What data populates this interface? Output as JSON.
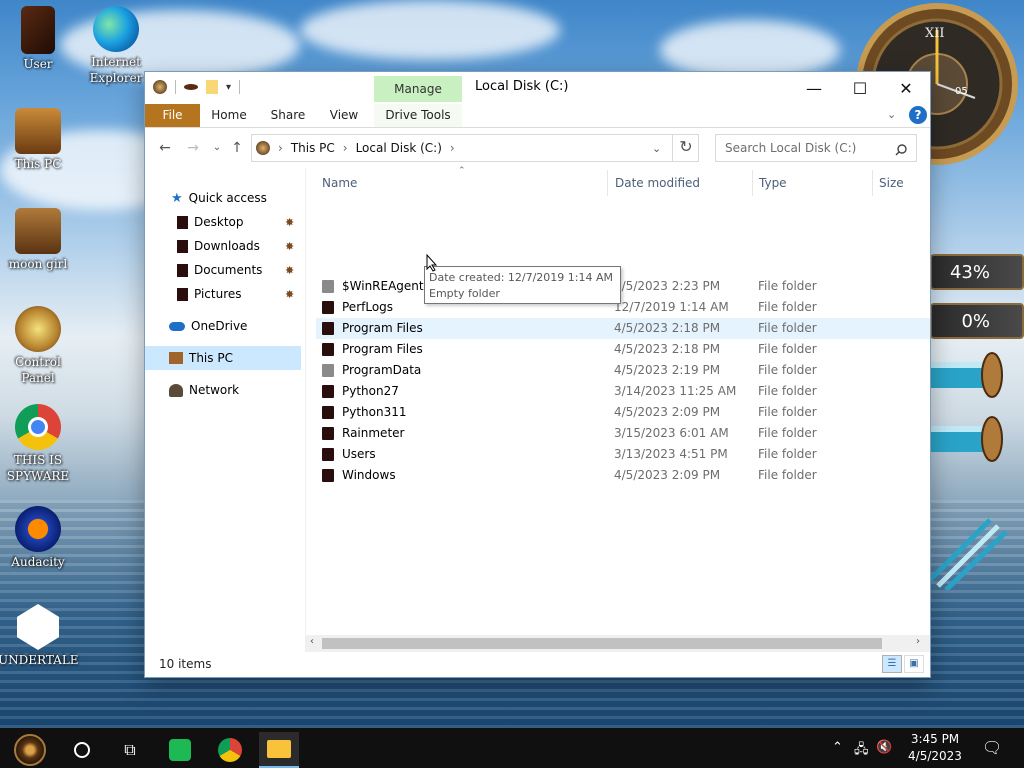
{
  "desktop": {
    "icons": [
      {
        "label": "User"
      },
      {
        "label": "Internet Explorer"
      },
      {
        "label": "This PC"
      },
      {
        "label": "moon girl"
      },
      {
        "label": "Control Panel"
      },
      {
        "label": "THIS IS SPYWARE"
      },
      {
        "label": "Audacity"
      },
      {
        "label": "UNDERTALE"
      }
    ],
    "widgets": {
      "gauge1": "43%",
      "gauge2": "0%",
      "clock_numeral": "XII",
      "clock_date": "05"
    }
  },
  "window": {
    "title": "Local Disk (C:)",
    "contextual_tab": "Manage",
    "ribbon_tabs": [
      "File",
      "Home",
      "Share",
      "View",
      "Drive Tools"
    ],
    "breadcrumb": [
      "This PC",
      "Local Disk (C:)"
    ],
    "search_placeholder": "Search Local Disk (C:)",
    "nav": {
      "quick_access": "Quick access",
      "quick_items": [
        "Desktop",
        "Downloads",
        "Documents",
        "Pictures"
      ],
      "onedrive": "OneDrive",
      "this_pc": "This PC",
      "network": "Network"
    },
    "columns": [
      "Name",
      "Date modified",
      "Type",
      "Size"
    ],
    "rows": [
      {
        "name": "$WinREAgent",
        "date": "4/5/2023 2:23 PM",
        "type": "File folder",
        "gray": true
      },
      {
        "name": "PerfLogs",
        "date": "12/7/2019 1:14 AM",
        "type": "File folder"
      },
      {
        "name": "Program Files",
        "date": "4/5/2023 2:18 PM",
        "type": "File folder"
      },
      {
        "name": "Program Files",
        "date": "4/5/2023 2:18 PM",
        "type": "File folder"
      },
      {
        "name": "ProgramData",
        "date": "4/5/2023 2:19 PM",
        "type": "File folder",
        "gray": true
      },
      {
        "name": "Python27",
        "date": "3/14/2023 11:25 AM",
        "type": "File folder"
      },
      {
        "name": "Python311",
        "date": "4/5/2023 2:09 PM",
        "type": "File folder"
      },
      {
        "name": "Rainmeter",
        "date": "3/15/2023 6:01 AM",
        "type": "File folder"
      },
      {
        "name": "Users",
        "date": "3/13/2023 4:51 PM",
        "type": "File folder"
      },
      {
        "name": "Windows",
        "date": "4/5/2023 2:09 PM",
        "type": "File folder"
      }
    ],
    "tooltip": {
      "line1": "Date created: 12/7/2019 1:14 AM",
      "line2": "Empty folder"
    },
    "status": "10 items"
  },
  "taskbar": {
    "time": "3:45 PM",
    "date": "4/5/2023"
  }
}
